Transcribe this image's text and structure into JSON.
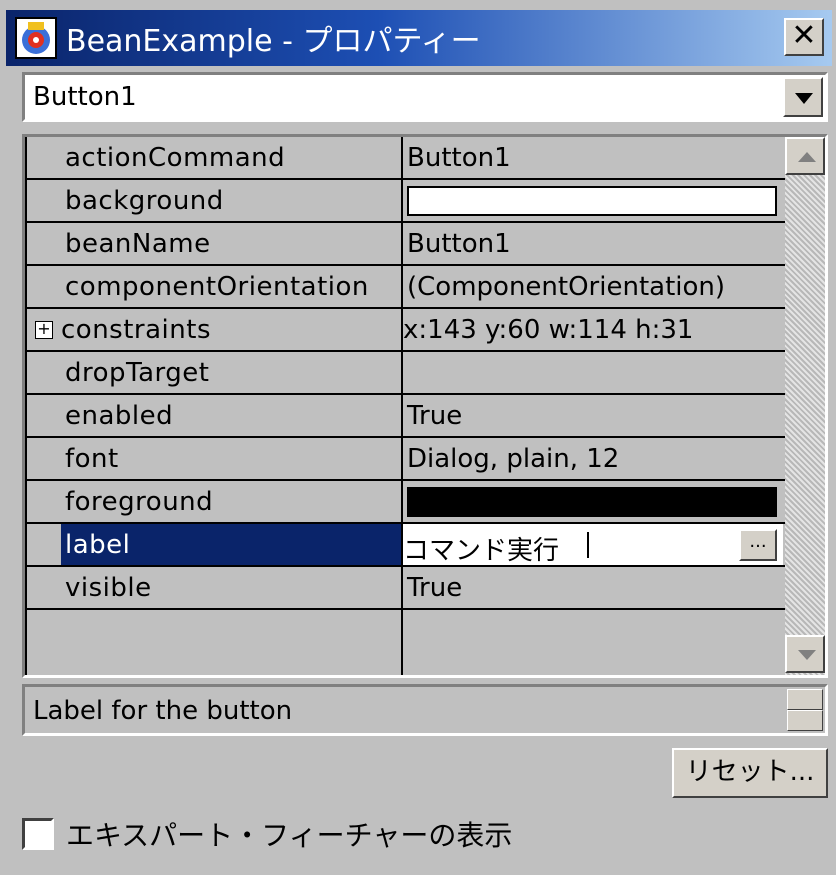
{
  "window": {
    "title": "BeanExample - プロパティー",
    "close_glyph": "✕",
    "active_title_color": "#0a246a"
  },
  "component_selector": {
    "value": "Button1"
  },
  "properties": [
    {
      "name": "actionCommand",
      "value": "Button1"
    },
    {
      "name": "background",
      "value": "",
      "swatch": "#ffffff"
    },
    {
      "name": "beanName",
      "value": "Button1"
    },
    {
      "name": "componentOrientation",
      "value": "(ComponentOrientation)"
    },
    {
      "name": "constraints",
      "value": "x:143 y:60 w:114 h:31",
      "expandable": true,
      "expander": "+"
    },
    {
      "name": "dropTarget",
      "value": ""
    },
    {
      "name": "enabled",
      "value": "True"
    },
    {
      "name": "font",
      "value": "Dialog, plain, 12"
    },
    {
      "name": "foreground",
      "value": "",
      "swatch": "#000000"
    },
    {
      "name": "label",
      "value": "コマンド実行",
      "selected": true,
      "editing": true,
      "ellipsis": "..."
    },
    {
      "name": "visible",
      "value": "True"
    }
  ],
  "description": {
    "text": "Label for the button"
  },
  "buttons": {
    "reset_label": "リセット..."
  },
  "options": {
    "expert_features_label": "エキスパート・フィーチャーの表示",
    "expert_features_checked": false
  }
}
